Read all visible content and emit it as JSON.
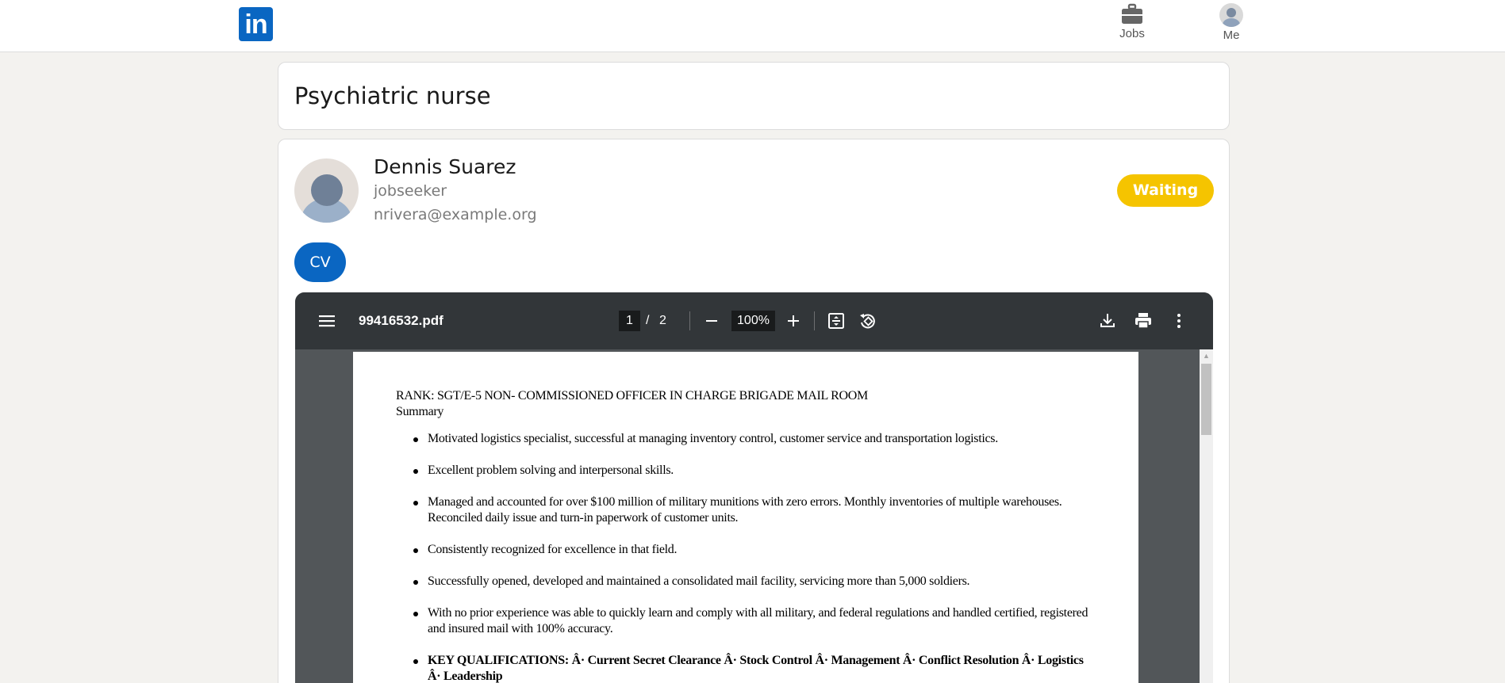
{
  "nav": {
    "logo_text": "in",
    "jobs_label": "Jobs",
    "me_label": "Me"
  },
  "job": {
    "title": "Psychiatric nurse"
  },
  "candidate": {
    "name": "Dennis Suarez",
    "role": "jobseeker",
    "email": "nrivera@example.org",
    "status": "Waiting",
    "cv_label": "CV"
  },
  "pdf": {
    "filename": "99416532.pdf",
    "current_page": "1",
    "page_separator": "/",
    "total_pages": "2",
    "zoom": "100%",
    "document": {
      "rank_line": "RANK: SGT/E-5 NON- COMMISSIONED OFFICER IN CHARGE BRIGADE MAIL ROOM",
      "summary_heading": "Summary",
      "bullets": [
        "Motivated logistics specialist, successful at managing inventory control, customer service and transportation logistics.",
        "Excellent problem solving and interpersonal skills.",
        "Managed and accounted for over $100 million of military munitions with zero errors. Monthly inventories of multiple warehouses. Reconciled daily issue and turn-in paperwork of customer units.",
        "Consistently recognized for excellence in that field.",
        "Successfully opened, developed and maintained a consolidated mail facility, servicing more than 5,000 soldiers.",
        "With no prior experience was able to quickly learn and comply with all military, and federal regulations and handled certified, registered and insured mail with 100% accuracy.",
        "KEY QUALIFICATIONS: Â· Current Secret Clearance Â· Stock Control Â· Management Â· Conflict Resolution Â· Logistics Â· Leadership"
      ]
    }
  },
  "colors": {
    "brand": "#0a66c2",
    "status_waiting": "#f5c400",
    "pdf_toolbar": "#323639",
    "pdf_background": "#525659"
  }
}
